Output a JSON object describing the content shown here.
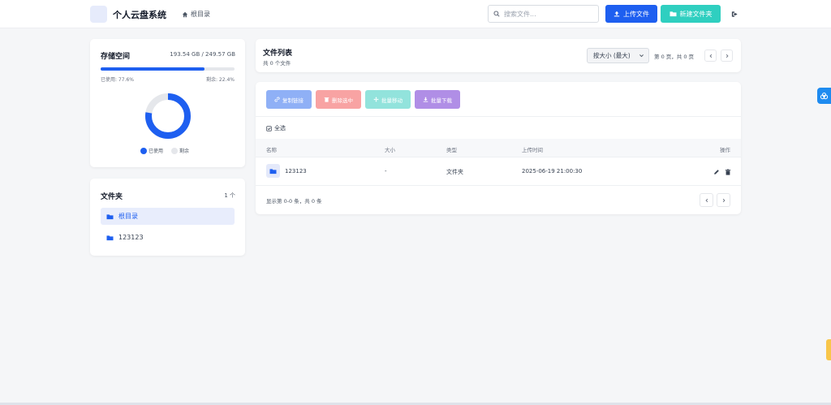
{
  "header": {
    "app_title": "个人云盘系统",
    "breadcrumb": "根目录",
    "search_placeholder": "搜索文件...",
    "upload_label": "上传文件",
    "new_folder_label": "新建文件夹"
  },
  "storage": {
    "title": "存储空间",
    "amount": "193.54 GB / 249.57 GB",
    "used_label": "已使用: 77.6%",
    "free_label": "剩余: 22.4%",
    "used_fraction": 0.776,
    "legend_used": "已使用",
    "legend_free": "剩余"
  },
  "folders": {
    "title": "文件夹",
    "count": "1 个",
    "items": [
      {
        "label": "根目录",
        "active": true
      },
      {
        "label": "123123",
        "active": false
      }
    ]
  },
  "file_list": {
    "title": "文件列表",
    "subtitle": "共 0 个文件",
    "sort_label": "按大小 (最大)",
    "page_info": "第 0 页，共 0 页"
  },
  "actions": {
    "copy_link": "复制链接",
    "delete_selected": "删除选中",
    "batch_move": "批量移动",
    "batch_download": "批量下载",
    "select_all": "全选"
  },
  "table": {
    "columns": {
      "name": "名称",
      "size": "大小",
      "type": "类型",
      "upload_time": "上传时间",
      "ops": "操作"
    },
    "rows": [
      {
        "name": "123123",
        "size": "-",
        "type": "文件夹",
        "upload_time": "2025-06-19 21:00:30"
      }
    ],
    "footer": "显示第 0-0 条，共 0 条"
  },
  "colors": {
    "primary": "#1e5ff0",
    "teal": "#2fcfc0",
    "copy_btn": "#8fb0f6",
    "delete_btn": "#f8a3a3",
    "move_btn": "#92e3dc",
    "download_btn": "#b08ee6"
  },
  "icons": [
    "search-icon",
    "upload-icon",
    "folder-icon",
    "logout-icon",
    "home-icon",
    "link-icon",
    "trash-icon",
    "move-icon",
    "download-icon",
    "check-square-icon",
    "edit-icon",
    "chevron-left-icon",
    "chevron-right-icon",
    "chevron-down-icon"
  ]
}
